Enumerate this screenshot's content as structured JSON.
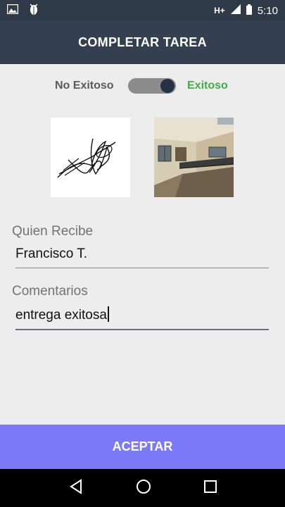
{
  "status_bar": {
    "network": "H+",
    "time": "5:10",
    "icons": [
      "image-icon",
      "bug-notification-icon",
      "signal-icon",
      "battery-icon"
    ]
  },
  "toolbar": {
    "title": "COMPLETAR TAREA"
  },
  "result_switch": {
    "off_label": "No Exitoso",
    "on_label": "Exitoso",
    "on_color": "#3fae49"
  },
  "attachments": [
    "signature",
    "photo"
  ],
  "form": {
    "receiver_label": "Quien Recibe",
    "receiver_value": "Francisco T.",
    "comments_label": "Comentarios",
    "comments_value": "entrega exitosa"
  },
  "accept_button": {
    "label": "ACEPTAR",
    "color": "#7b79f7"
  },
  "nav_bar": {
    "icons": [
      "back-icon",
      "home-icon",
      "recents-icon"
    ]
  },
  "colors": {
    "toolbar": "#34404f",
    "statusbar": "#2e3a48"
  }
}
